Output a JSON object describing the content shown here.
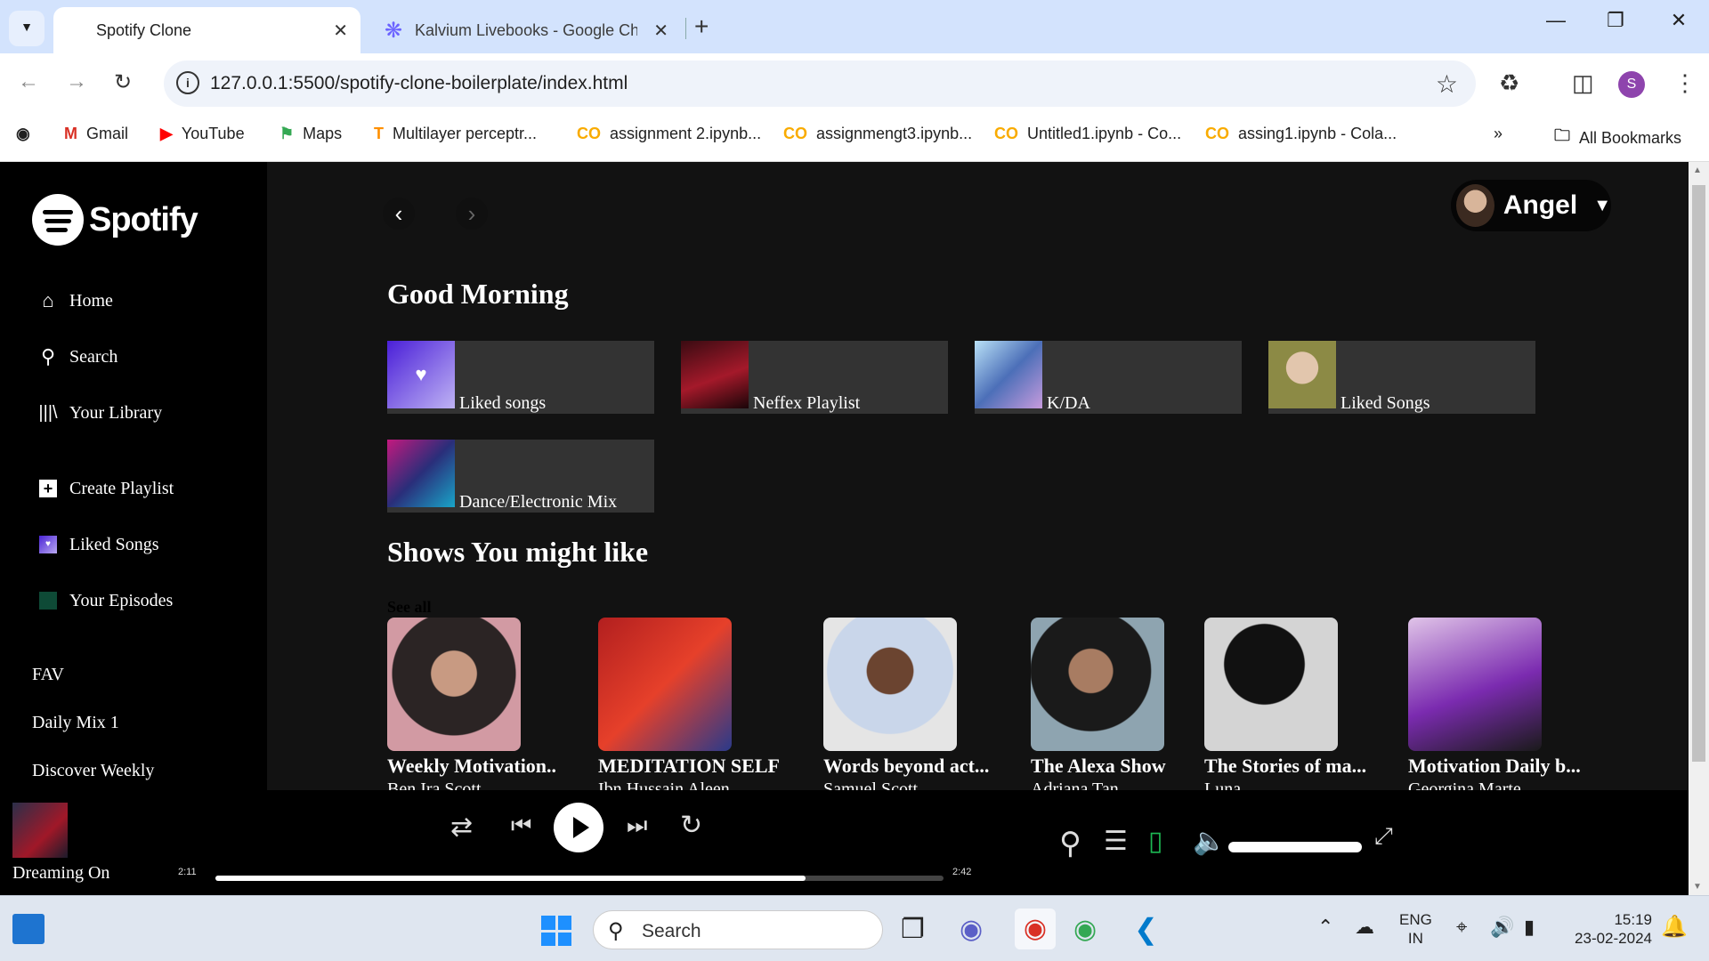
{
  "browser": {
    "tabs": [
      {
        "title": "Spotify Clone",
        "active": true
      },
      {
        "title": "Kalvium Livebooks - Google Ch",
        "active": false
      }
    ],
    "url": "127.0.0.1:5500/spotify-clone-boilerplate/index.html",
    "profile_initial": "S",
    "bookmarks": [
      {
        "label": "Gmail",
        "icon": "gmail-icon"
      },
      {
        "label": "YouTube",
        "icon": "youtube-icon"
      },
      {
        "label": "Maps",
        "icon": "maps-icon"
      },
      {
        "label": "Multilayer perceptr...",
        "icon": "tensorflow-icon"
      },
      {
        "label": "assignment 2.ipynb...",
        "icon": "colab-icon"
      },
      {
        "label": "assignmengt3.ipynb...",
        "icon": "colab-icon"
      },
      {
        "label": "Untitled1.ipynb - Co...",
        "icon": "colab-icon"
      },
      {
        "label": "assing1.ipynb - Cola...",
        "icon": "colab-icon"
      }
    ],
    "all_bookmarks": "All Bookmarks"
  },
  "sidebar": {
    "logo_text": "Spotify",
    "nav": [
      {
        "label": "Home",
        "icon": "home-icon"
      },
      {
        "label": "Search",
        "icon": "search-icon"
      },
      {
        "label": "Your Library",
        "icon": "library-icon"
      }
    ],
    "actions": [
      {
        "label": "Create Playlist",
        "icon": "plus-icon"
      },
      {
        "label": "Liked Songs",
        "icon": "heart-icon"
      },
      {
        "label": "Your Episodes",
        "icon": "episodes-icon"
      }
    ],
    "playlists": [
      "FAV",
      "Daily Mix 1",
      "Discover Weekly"
    ]
  },
  "main": {
    "user_name": "Angel",
    "greeting": "Good Morning",
    "quick_picks": [
      {
        "label": "Liked songs"
      },
      {
        "label": "Neffex Playlist"
      },
      {
        "label": "K/DA"
      },
      {
        "label": "Liked Songs"
      },
      {
        "label": "Dance/Electronic Mix"
      }
    ],
    "shows_heading": "Shows You might like",
    "see_all": "See all",
    "shows": [
      {
        "title": "Weekly Motivation..",
        "author": "Ben Ira Scott"
      },
      {
        "title": "MEDITATION SELF",
        "author": "Ibn Hussain Aleen"
      },
      {
        "title": "Words beyond act...",
        "author": "Samuel Scott"
      },
      {
        "title": "The Alexa Show",
        "author": "Adriana Tan"
      },
      {
        "title": "The Stories of ma...",
        "author": "Luna"
      },
      {
        "title": "Motivation Daily b...",
        "author": "Georgina Marte"
      }
    ]
  },
  "player": {
    "now_playing": "Dreaming On",
    "elapsed": "2:11",
    "duration": "2:42",
    "progress": 0.81,
    "volume": 1.0
  },
  "taskbar": {
    "search_label": "Search",
    "lang_line1": "ENG",
    "lang_line2": "IN",
    "time": "15:19",
    "date": "23-02-2024"
  }
}
